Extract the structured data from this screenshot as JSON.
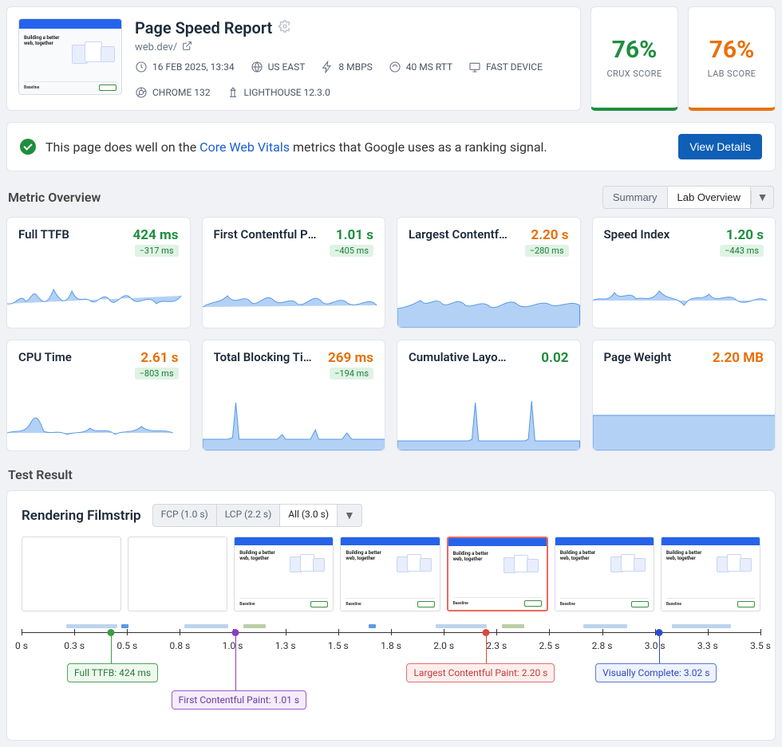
{
  "header": {
    "title": "Page Speed Report",
    "url": "web.dev/",
    "meta": {
      "date": "16 FEB 2025, 13:34",
      "region": "US EAST",
      "bandwidth": "8 MBPS",
      "rtt": "40 MS RTT",
      "device": "FAST DEVICE",
      "browser": "CHROME 132",
      "lighthouse": "LIGHTHOUSE 12.3.0"
    },
    "thumb_text": "Building a better web, together",
    "thumb_section": "Baseline"
  },
  "scores": {
    "crux": {
      "value": "76%",
      "label": "CRUX SCORE"
    },
    "lab": {
      "value": "76%",
      "label": "LAB SCORE"
    }
  },
  "banner": {
    "prefix": "This page does well on the ",
    "link": "Core Web Vitals",
    "suffix": " metrics that Google uses as a ranking signal.",
    "button": "View Details"
  },
  "overview": {
    "title": "Metric Overview",
    "segments": {
      "summary": "Summary",
      "lab": "Lab Overview"
    }
  },
  "metrics": [
    {
      "name": "Full TTFB",
      "value": "424 ms",
      "cls": "val-green",
      "delta": "−317 ms",
      "spark": "a"
    },
    {
      "name": "First Contentful Pa…",
      "value": "1.01 s",
      "cls": "val-green",
      "delta": "−405 ms",
      "spark": "b"
    },
    {
      "name": "Largest Contentful…",
      "value": "2.20 s",
      "cls": "val-orange",
      "delta": "−280 ms",
      "spark": "c"
    },
    {
      "name": "Speed Index",
      "value": "1.20 s",
      "cls": "val-green",
      "delta": "−443 ms",
      "spark": "d"
    },
    {
      "name": "CPU Time",
      "value": "2.61 s",
      "cls": "val-orange",
      "delta": "−803 ms",
      "spark": "e"
    },
    {
      "name": "Total Blocking Ti…",
      "value": "269 ms",
      "cls": "val-orange",
      "delta": "−194 ms",
      "spark": "f"
    },
    {
      "name": "Cumulative Layout S…",
      "value": "0.02",
      "cls": "val-green",
      "delta": "",
      "spark": "g"
    },
    {
      "name": "Page Weight",
      "value": "2.20 MB",
      "cls": "val-orange",
      "delta": "",
      "spark": "h"
    }
  ],
  "test_result_title": "Test Result",
  "filmstrip": {
    "title": "Rendering Filmstrip",
    "pills": {
      "fcp": "FCP (1.0 s)",
      "lcp": "LCP (2.2 s)",
      "all": "All (3.0 s)"
    },
    "tick_labels": [
      "0 s",
      "0.3 s",
      "0.5 s",
      "0.8 s",
      "1.0 s",
      "1.3 s",
      "1.5 s",
      "1.8 s",
      "2.0 s",
      "2.3 s",
      "2.5 s",
      "2.8 s",
      "3.0 s",
      "3.3 s",
      "3.5 s"
    ],
    "markers": {
      "ttfb": {
        "label": "Full TTFB: 424 ms",
        "pos_pct": 12.1
      },
      "fcp": {
        "label": "First Contentful Paint: 1.01 s",
        "pos_pct": 28.9
      },
      "lcp": {
        "label": "Largest Contentful Paint: 2.20 s",
        "pos_pct": 62.9
      },
      "vc": {
        "label": "Visually Complete: 3.02 s",
        "pos_pct": 86.3
      }
    }
  }
}
